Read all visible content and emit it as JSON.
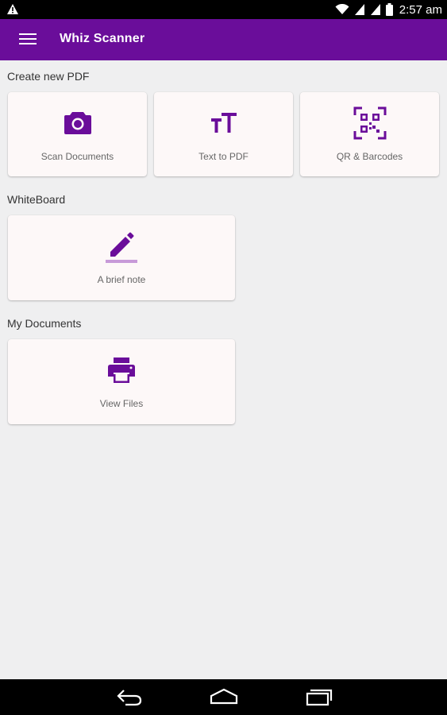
{
  "status_bar": {
    "time": "2:57 am"
  },
  "app_bar": {
    "title": "Whiz Scanner"
  },
  "sections": {
    "create_pdf": {
      "title": "Create new PDF",
      "cards": [
        {
          "label": "Scan Documents",
          "icon": "camera-icon"
        },
        {
          "label": "Text to PDF",
          "icon": "text-size-icon"
        },
        {
          "label": "QR & Barcodes",
          "icon": "qr-code-icon"
        }
      ]
    },
    "whiteboard": {
      "title": "WhiteBoard",
      "cards": [
        {
          "label": "A brief note",
          "icon": "pencil-icon"
        }
      ]
    },
    "my_documents": {
      "title": "My Documents",
      "cards": [
        {
          "label": "View Files",
          "icon": "printer-icon"
        }
      ]
    }
  },
  "colors": {
    "primary": "#6a0d9a",
    "background": "#efeff0",
    "card": "#fdf8f8"
  }
}
